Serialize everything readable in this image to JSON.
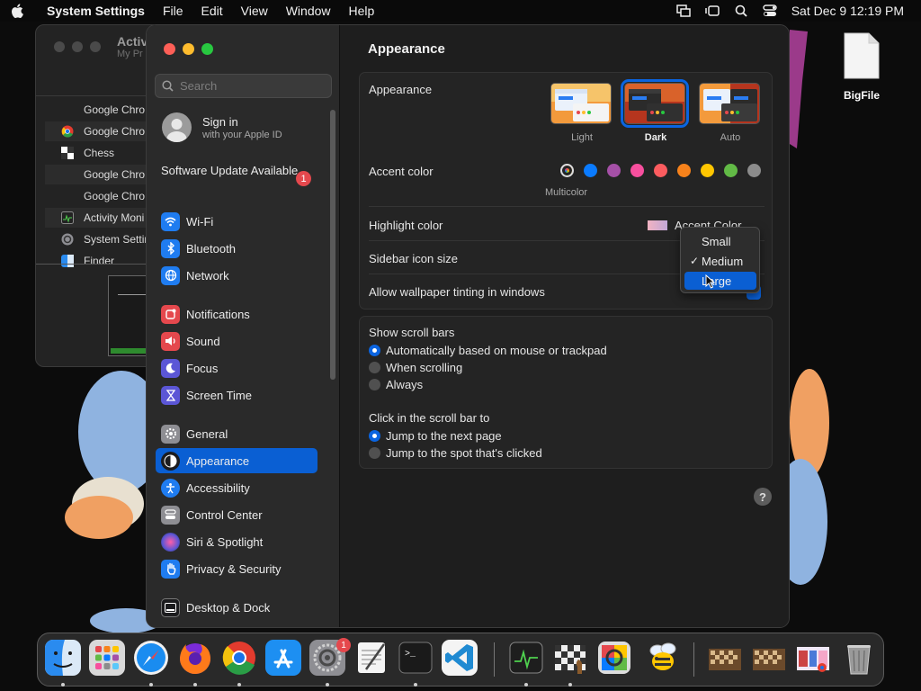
{
  "menubar": {
    "app_name": "System Settings",
    "items": [
      "File",
      "Edit",
      "View",
      "Window",
      "Help"
    ],
    "clock": "Sat Dec 9  12:19 PM"
  },
  "background_window": {
    "title": "Activ",
    "subtitle": "My Pr",
    "rows": [
      {
        "label": "Google Chro",
        "icon": "none"
      },
      {
        "label": "Google Chro",
        "icon": "chrome-icon"
      },
      {
        "label": "Chess",
        "icon": "chess-icon"
      },
      {
        "label": "Google Chro",
        "icon": "none"
      },
      {
        "label": "Google Chro",
        "icon": "none"
      },
      {
        "label": "Activity Moni",
        "icon": "activity-monitor-icon"
      },
      {
        "label": "System Settir",
        "icon": "system-settings-icon"
      },
      {
        "label": "Finder",
        "icon": "finder-icon"
      }
    ]
  },
  "sidebar": {
    "search_placeholder": "Search",
    "signin_title": "Sign in",
    "signin_subtitle": "with your Apple ID",
    "update_label": "Software Update Available",
    "update_badge": "1",
    "items": [
      {
        "label": "Wi-Fi",
        "icon": "wifi-icon",
        "color": "#1f7cf0"
      },
      {
        "label": "Bluetooth",
        "icon": "bluetooth-icon",
        "color": "#1f7cf0"
      },
      {
        "label": "Network",
        "icon": "globe-icon",
        "color": "#1f7cf0"
      },
      {
        "label": "Notifications",
        "icon": "bell-icon",
        "color": "#e5484d"
      },
      {
        "label": "Sound",
        "icon": "speaker-icon",
        "color": "#e5484d"
      },
      {
        "label": "Focus",
        "icon": "moon-icon",
        "color": "#5b56d6"
      },
      {
        "label": "Screen Time",
        "icon": "hourglass-icon",
        "color": "#5b56d6"
      },
      {
        "label": "General",
        "icon": "gear-icon",
        "color": "#8e8e93"
      },
      {
        "label": "Appearance",
        "icon": "appearance-icon",
        "color": "#1c1c1e"
      },
      {
        "label": "Accessibility",
        "icon": "accessibility-icon",
        "color": "#1f7cf0"
      },
      {
        "label": "Control Center",
        "icon": "control-center-icon",
        "color": "#8e8e93"
      },
      {
        "label": "Siri & Spotlight",
        "icon": "siri-icon",
        "color": "#b04bd8"
      },
      {
        "label": "Privacy & Security",
        "icon": "hand-icon",
        "color": "#1f7cf0"
      },
      {
        "label": "Desktop & Dock",
        "icon": "dock-icon",
        "color": "#1c1c1e"
      }
    ],
    "selected": "Appearance"
  },
  "content": {
    "title": "Appearance",
    "appearance_label": "Appearance",
    "themes": [
      "Light",
      "Dark",
      "Auto"
    ],
    "selected_theme": "Dark",
    "accent_label": "Accent color",
    "accent_colors": [
      "multicolor",
      "#0a7bff",
      "#a550a7",
      "#f74f9e",
      "#fc5c5f",
      "#f7821b",
      "#ffc600",
      "#62ba46",
      "#8c8c8c"
    ],
    "multicolor_label": "Multicolor",
    "highlight_label": "Highlight color",
    "highlight_value": "Accent Color",
    "sidebar_icon_label": "Sidebar icon size",
    "wallpaper_tint_label": "Allow wallpaper tinting in windows",
    "scrollbars_label": "Show scroll bars",
    "scrollbar_options": [
      "Automatically based on mouse or trackpad",
      "When scrolling",
      "Always"
    ],
    "scrollbar_selected": 0,
    "click_label": "Click in the scroll bar to",
    "click_options": [
      "Jump to the next page",
      "Jump to the spot that's clicked"
    ],
    "click_selected": 0,
    "help": "?"
  },
  "dropdown": {
    "options": [
      "Small",
      "Medium",
      "Large"
    ],
    "checked": "Medium",
    "highlighted": "Large"
  },
  "desktop": {
    "file_label": "BigFile"
  },
  "dock": {
    "settings_badge": "1",
    "apps": [
      "finder-icon",
      "launchpad-icon",
      "safari-icon",
      "firefox-icon",
      "chrome-icon",
      "app-store-icon",
      "system-settings-icon",
      "textedit-icon",
      "terminal-icon",
      "vscode-icon",
      "activity-monitor-icon",
      "chess-icon",
      "color-picker-icon",
      "bee-icon",
      "minimized-window-1",
      "minimized-window-2",
      "minimized-window-3",
      "trash-icon"
    ]
  }
}
